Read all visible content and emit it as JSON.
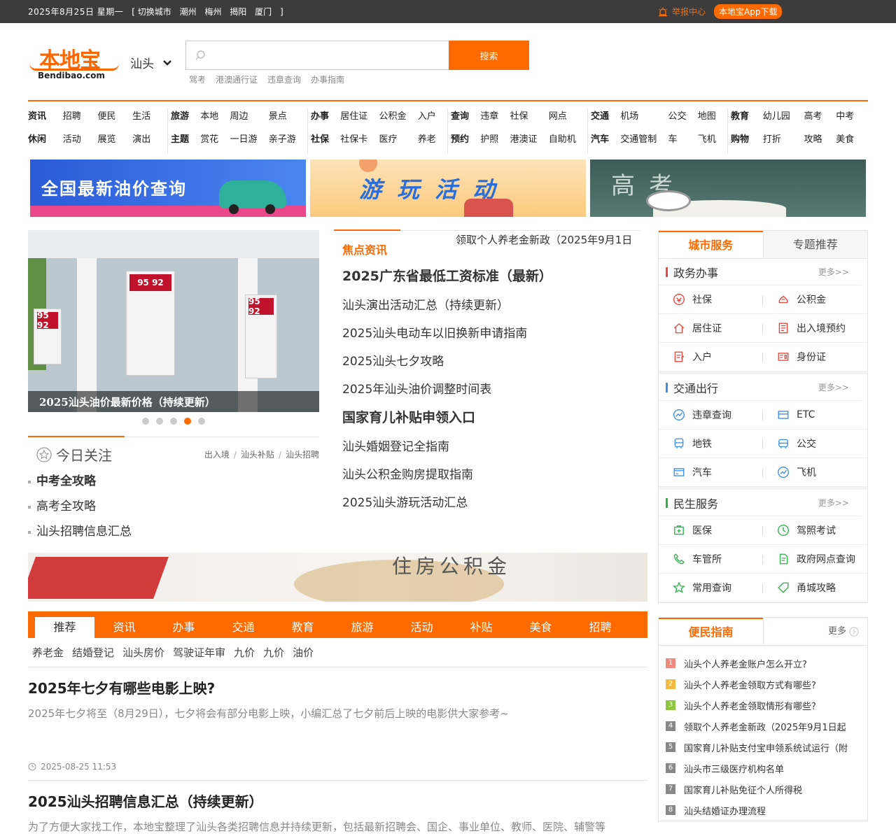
{
  "topbar": {
    "date": "2025年8月25日  星期一",
    "city_switch_label": "[ 切换城市",
    "cities": [
      "潮州",
      "梅州",
      "揭阳",
      "厦门"
    ],
    "close_bracket": "]",
    "report": "举报中心",
    "app_download": "本地宝App下载"
  },
  "header": {
    "logo_cn": "本地宝",
    "logo_en": "Bendibao.com",
    "current_city": "汕头",
    "search_button": "搜索",
    "hot_words": [
      "驾考",
      "港澳通行证",
      "违章查询",
      "办事指南"
    ]
  },
  "nav": [
    [
      {
        "t": "资讯",
        "b": true
      },
      {
        "t": "招聘"
      },
      {
        "t": "便民"
      },
      {
        "t": "生活"
      },
      {
        "t": "休闲",
        "b": true
      },
      {
        "t": "活动"
      },
      {
        "t": "展览"
      },
      {
        "t": "演出"
      }
    ],
    [
      {
        "t": "旅游",
        "b": true
      },
      {
        "t": "本地"
      },
      {
        "t": "周边"
      },
      {
        "t": "景点"
      },
      {
        "t": "主题",
        "b": true
      },
      {
        "t": "赏花"
      },
      {
        "t": "一日游"
      },
      {
        "t": "亲子游"
      }
    ],
    [
      {
        "t": "办事",
        "b": true
      },
      {
        "t": "居住证"
      },
      {
        "t": "公积金"
      },
      {
        "t": "入户"
      },
      {
        "t": "社保",
        "b": true
      },
      {
        "t": "社保卡"
      },
      {
        "t": "医疗"
      },
      {
        "t": "养老"
      }
    ],
    [
      {
        "t": "查询",
        "b": true
      },
      {
        "t": "违章"
      },
      {
        "t": "社保"
      },
      {
        "t": "网点"
      },
      {
        "t": "预约",
        "b": true
      },
      {
        "t": "护照"
      },
      {
        "t": "港澳证"
      },
      {
        "t": "自助机"
      }
    ],
    [
      {
        "t": "交通",
        "b": true
      },
      {
        "t": "机场"
      },
      {
        "t": "公交"
      },
      {
        "t": "地图"
      },
      {
        "t": "汽车",
        "b": true
      },
      {
        "t": "交通管制"
      },
      {
        "t": "车"
      },
      {
        "t": "飞机"
      }
    ],
    [
      {
        "t": "教育",
        "b": true
      },
      {
        "t": "幼儿园"
      },
      {
        "t": "高考"
      },
      {
        "t": "中考"
      },
      {
        "t": "购物",
        "b": true
      },
      {
        "t": "打折"
      },
      {
        "t": "攻略"
      },
      {
        "t": "美食"
      }
    ]
  ],
  "banners": {
    "b1": "全国最新油价查询",
    "b2": "游玩活动",
    "b3": "高考"
  },
  "slider": {
    "caption": "2025汕头油价最新价格（持续更新）",
    "pump_signs": [
      "95 92",
      "95 92",
      "95 92"
    ],
    "dot_count": 5,
    "active_dot": 4
  },
  "focus": {
    "title": "焦点资讯",
    "marquee": "领取个人养老金新政（2025年9月1日",
    "items": [
      {
        "t": "2025广东省最低工资标准（最新）",
        "big": true
      },
      {
        "t": "汕头演出活动汇总（持续更新）"
      },
      {
        "t": "2025汕头电动车以旧换新申请指南"
      },
      {
        "t": "2025汕头七夕攻略"
      },
      {
        "t": "2025年汕头油价调整时间表"
      },
      {
        "t": "国家育儿补贴申领入口",
        "big": true
      },
      {
        "t": "汕头婚姻登记全指南"
      },
      {
        "t": "汕头公积金购房提取指南"
      },
      {
        "t": "2025汕头游玩活动汇总"
      }
    ]
  },
  "today": {
    "title": "今日关注",
    "links": [
      "出入境",
      "汕头补贴",
      "汕头招聘"
    ],
    "items": [
      {
        "t": "中考全攻略",
        "b": true
      },
      {
        "t": "高考全攻略"
      },
      {
        "t": "汕头招聘信息汇总"
      }
    ]
  },
  "gjj_banner": "住房公积金",
  "tabs": [
    "推荐",
    "资讯",
    "办事",
    "交通",
    "教育",
    "旅游",
    "活动",
    "补贴",
    "美食",
    "招聘"
  ],
  "subtags": [
    "养老金",
    "结婚登记",
    "汕头房价",
    "驾驶证年审",
    "九价",
    "九价",
    "油价"
  ],
  "articles": [
    {
      "title": "2025年七夕有哪些电影上映?",
      "summary": "2025年七夕将至（8月29日），七夕将会有部分电影上映，小编汇总了七夕前后上映的电影供大家参考~",
      "time": "2025-08-25 11:53"
    },
    {
      "title": "2025汕头招聘信息汇总（持续更新）",
      "summary": "为了方便大家找工作，本地宝整理了汕头各类招聘信息并持续更新，包括最新招聘会、国企、事业单位、教师、医院、辅警等",
      "time": ""
    }
  ],
  "services": {
    "tab_active": "城市服务",
    "tab_other": "专题推荐",
    "more": "更多>>",
    "sections": [
      {
        "name": "政务办事",
        "color": "#e8453c",
        "items": [
          {
            "label": "社保",
            "icon": "social-security-icon",
            "color": "#e8453c"
          },
          {
            "label": "公积金",
            "icon": "fund-icon",
            "color": "#e8453c"
          },
          {
            "label": "居住证",
            "icon": "home-icon",
            "color": "#e8453c"
          },
          {
            "label": "出入境预约",
            "icon": "passport-icon",
            "color": "#e8453c"
          },
          {
            "label": "入户",
            "icon": "form-icon",
            "color": "#e8453c"
          },
          {
            "label": "身份证",
            "icon": "id-card-icon",
            "color": "#e8453c"
          }
        ]
      },
      {
        "name": "交通出行",
        "color": "#3a8ee6",
        "items": [
          {
            "label": "违章查询",
            "icon": "violation-icon",
            "color": "#3a8ee6"
          },
          {
            "label": "ETC",
            "icon": "etc-icon",
            "color": "#3a8ee6"
          },
          {
            "label": "地铁",
            "icon": "metro-icon",
            "color": "#3a8ee6"
          },
          {
            "label": "公交",
            "icon": "bus-icon",
            "color": "#3a8ee6"
          },
          {
            "label": "汽车",
            "icon": "car-icon",
            "color": "#3a8ee6"
          },
          {
            "label": "飞机",
            "icon": "plane-icon",
            "color": "#3a8ee6"
          }
        ]
      },
      {
        "name": "民生服务",
        "color": "#2bb34a",
        "items": [
          {
            "label": "医保",
            "icon": "medical-icon",
            "color": "#2bb34a"
          },
          {
            "label": "驾照考试",
            "icon": "clock-icon",
            "color": "#2bb34a"
          },
          {
            "label": "车管所",
            "icon": "phone-icon",
            "color": "#2bb34a"
          },
          {
            "label": "政府网点查询",
            "icon": "document-icon",
            "color": "#2bb34a"
          },
          {
            "label": "常用查询",
            "icon": "star-icon",
            "color": "#2bb34a"
          },
          {
            "label": "甬城攻略",
            "icon": "tag-icon",
            "color": "#2bb34a"
          }
        ]
      }
    ]
  },
  "guide": {
    "title": "便民指南",
    "more": "更多",
    "items": [
      {
        "n": "1",
        "t": "汕头个人养老金账户怎么开立?",
        "c": "#f08a7e"
      },
      {
        "n": "2",
        "t": "汕头个人养老金领取方式有哪些?",
        "c": "#f5b840"
      },
      {
        "n": "3",
        "t": "汕头个人养老金领取情形有哪些?",
        "c": "#8cc63f"
      },
      {
        "n": "4",
        "t": "领取个人养老金新政（2025年9月1日起",
        "c": "#888888"
      },
      {
        "n": "5",
        "t": "国家育儿补贴支付宝申领系统试运行（附",
        "c": "#888888"
      },
      {
        "n": "6",
        "t": "汕头市三级医疗机构名单",
        "c": "#888888"
      },
      {
        "n": "7",
        "t": "国家育儿补贴免征个人所得税",
        "c": "#888888"
      },
      {
        "n": "8",
        "t": "汕头结婚证办理流程",
        "c": "#888888"
      }
    ]
  }
}
